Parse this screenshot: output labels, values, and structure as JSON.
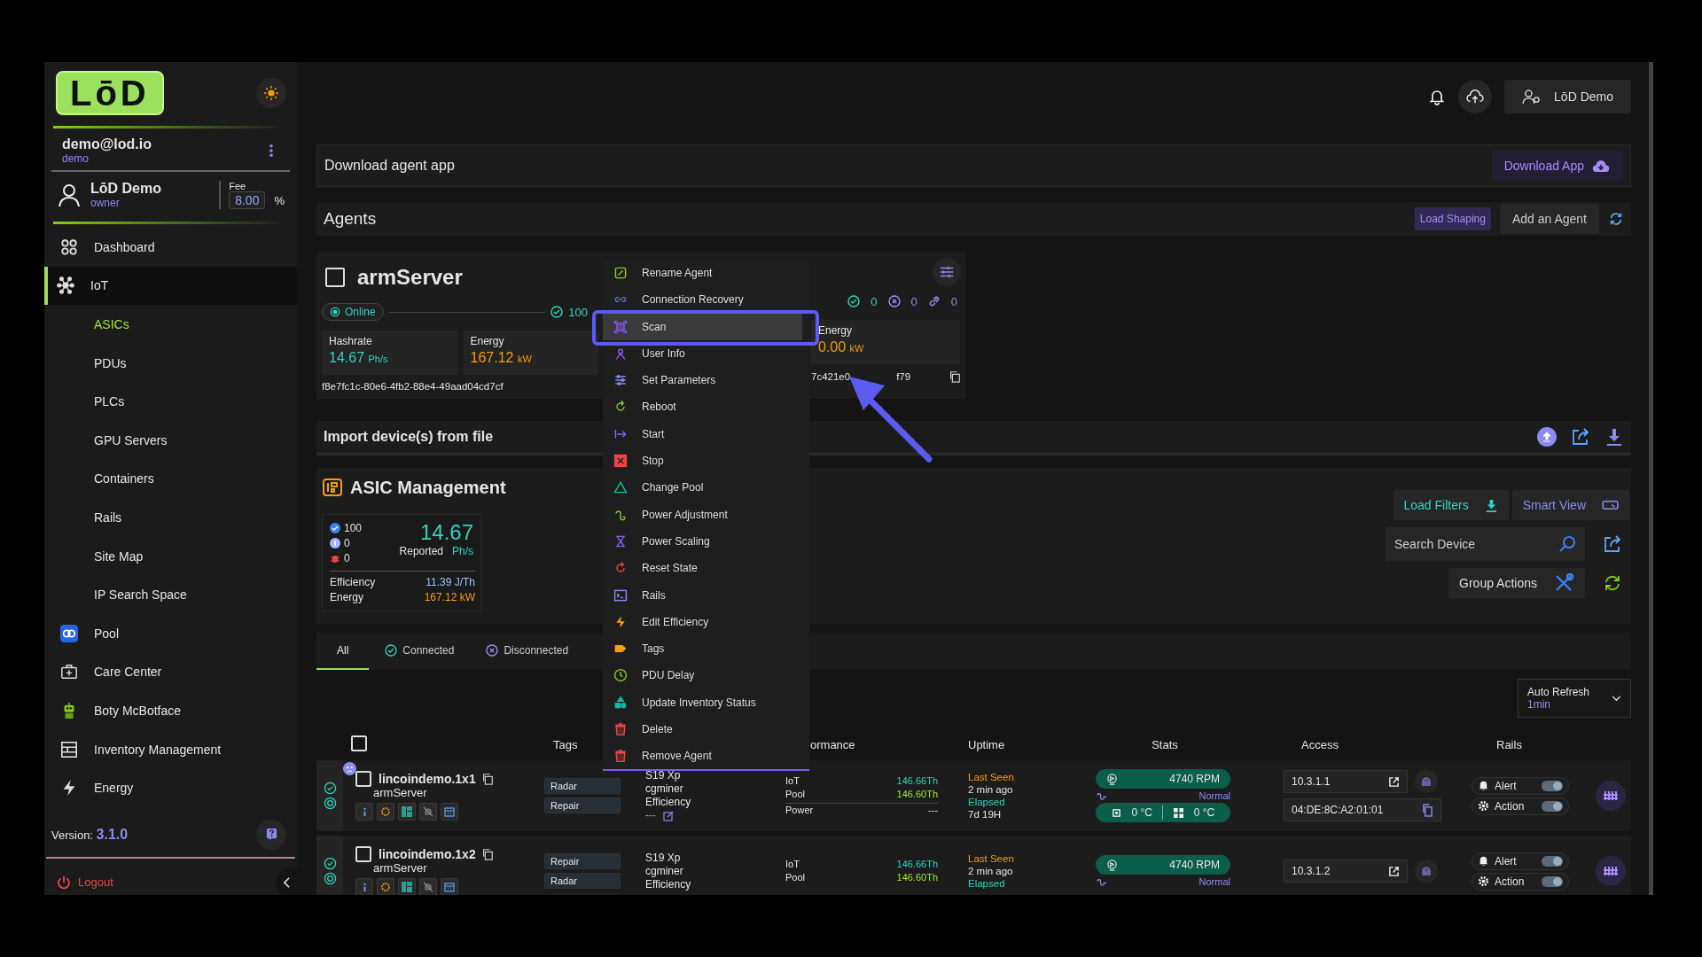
{
  "sidebar": {
    "logo": "LōD",
    "account": {
      "email": "demo@lod.io",
      "role": "demo"
    },
    "user": {
      "name": "LōD Demo",
      "role": "owner",
      "fee_label": "Fee",
      "fee": "8.00",
      "fee_unit": "%"
    },
    "nav": [
      {
        "label": "Dashboard",
        "selected": false
      },
      {
        "label": "IoT",
        "selected": true,
        "expanded": true,
        "children": [
          {
            "label": "ASICs",
            "selected": true
          },
          {
            "label": "PDUs",
            "selected": false
          },
          {
            "label": "PLCs",
            "selected": false
          },
          {
            "label": "GPU Servers",
            "selected": false
          },
          {
            "label": "Containers",
            "selected": false
          },
          {
            "label": "Rails",
            "selected": false
          },
          {
            "label": "Site Map",
            "selected": false
          },
          {
            "label": "IP Search Space",
            "selected": false
          }
        ]
      },
      {
        "label": "Pool",
        "selected": false
      },
      {
        "label": "Care Center",
        "selected": false
      },
      {
        "label": "Boty McBotface",
        "selected": false
      },
      {
        "label": "Inventory Management",
        "selected": false
      },
      {
        "label": "Energy",
        "selected": false
      }
    ],
    "version_label": "Version:",
    "version": "3.1.0",
    "logout": "Logout"
  },
  "header": {
    "user_button": "LōD Demo"
  },
  "download_panel": {
    "title": "Download agent app",
    "button": "Download App"
  },
  "agents_panel": {
    "title": "Agents",
    "load_shaping": "Load Shaping",
    "add_button": "Add an Agent"
  },
  "agents": [
    {
      "name": "armServer",
      "checked": false,
      "status": "Online",
      "connected": "100",
      "hashrate_label": "Hashrate",
      "hashrate": "14.67",
      "hashrate_unit": "Ph/s",
      "energy_label": "Energy",
      "energy": "167.12",
      "energy_unit": "kW",
      "uuid": "f8e7fc1c-80e6-4fb2-88e4-49aad04cd7cf"
    },
    {
      "connected": "0",
      "disconnected": "0",
      "linked": "0",
      "energy_label": "Energy",
      "energy": "0.00",
      "energy_unit": "kW",
      "uuid_start": "7c421e0",
      "uuid_end": "f79"
    }
  ],
  "agent_menu": {
    "items": [
      {
        "label": "Rename Agent",
        "selected": false
      },
      {
        "label": "Connection Recovery",
        "selected": false
      },
      {
        "label": "Scan",
        "selected": true
      },
      {
        "label": "User Info",
        "selected": false
      },
      {
        "label": "Set Parameters",
        "selected": false
      },
      {
        "label": "Reboot",
        "selected": false
      },
      {
        "label": "Start",
        "selected": false
      },
      {
        "label": "Stop",
        "selected": false
      },
      {
        "label": "Change Pool",
        "selected": false
      },
      {
        "label": "Power Adjustment",
        "selected": false
      },
      {
        "label": "Power Scaling",
        "selected": false
      },
      {
        "label": "Reset State",
        "selected": false
      },
      {
        "label": "Rails",
        "selected": false
      },
      {
        "label": "Edit Efficiency",
        "selected": false
      },
      {
        "label": "Tags",
        "selected": false
      },
      {
        "label": "PDU Delay",
        "selected": false
      },
      {
        "label": "Update Inventory Status",
        "selected": false
      },
      {
        "label": "Delete",
        "selected": false
      },
      {
        "label": "Remove Agent",
        "selected": false
      }
    ]
  },
  "import_panel": {
    "title": "Import device(s) from file"
  },
  "asic_management": {
    "title": "ASIC Management",
    "summary": {
      "online": "100",
      "idle": "0",
      "faulty": "0",
      "hashrate": "14.67",
      "hashrate_label": "Reported",
      "hashrate_unit": "Ph/s",
      "efficiency_label": "Efficiency",
      "efficiency": "11.39 J/Th",
      "energy_label": "Energy",
      "energy": "167.12 kW"
    },
    "load_filters": "Load Filters",
    "smart_view": "Smart View",
    "search": {
      "placeholder": "Search Device"
    },
    "group_actions": "Group Actions"
  },
  "tabs": [
    {
      "label": "All",
      "selected": true
    },
    {
      "label": "Connected",
      "selected": false
    },
    {
      "label": "Disconnected",
      "selected": false
    }
  ],
  "auto_refresh": {
    "label": "Auto Refresh",
    "value": "1min"
  },
  "table": {
    "all_checked": false,
    "columns": [
      "Tags",
      "ormance",
      "Uptime",
      "Stats",
      "Access",
      "Rails"
    ],
    "rows": [
      {
        "badge": true,
        "name": "lincoindemo.1x1",
        "agent": "armServer",
        "checked": false,
        "tags": [
          "Radar",
          "Repair"
        ],
        "model": "S19 Xp",
        "miner": "cgminer",
        "efficiency_label": "Efficiency",
        "efficiency": "---",
        "iot_label": "IoT",
        "iot": "146.66Th",
        "pool_label": "Pool",
        "pool": "146.60Th",
        "power_label": "Power",
        "power": "---",
        "last_seen_label": "Last Seen",
        "last_seen": "2 min ago",
        "elapsed_label": "Elapsed",
        "elapsed": "7d 19H",
        "fan": "4740 RPM",
        "power_mode": "Normal",
        "chip_temp": "0 °C",
        "board_temp": "0 °C",
        "ip": "10.3.1.1",
        "mac": "04:DE:8C:A2:01:01",
        "alert_label": "Alert",
        "alert": true,
        "action_label": "Action",
        "action": true
      },
      {
        "badge": false,
        "name": "lincoindemo.1x2",
        "agent": "armServer",
        "checked": false,
        "tags": [
          "Repair",
          "Radar"
        ],
        "model": "S19 Xp",
        "miner": "cgminer",
        "efficiency_label": "Efficiency",
        "iot_label": "IoT",
        "iot": "146.66Th",
        "pool_label": "Pool",
        "pool": "146.60Th",
        "last_seen_label": "Last Seen",
        "last_seen": "2 min ago",
        "elapsed_label": "Elapsed",
        "fan": "4740 RPM",
        "power_mode": "Normal",
        "ip": "10.3.1.2",
        "alert_label": "Alert",
        "alert": true,
        "action_label": "Action",
        "action": true
      }
    ]
  }
}
